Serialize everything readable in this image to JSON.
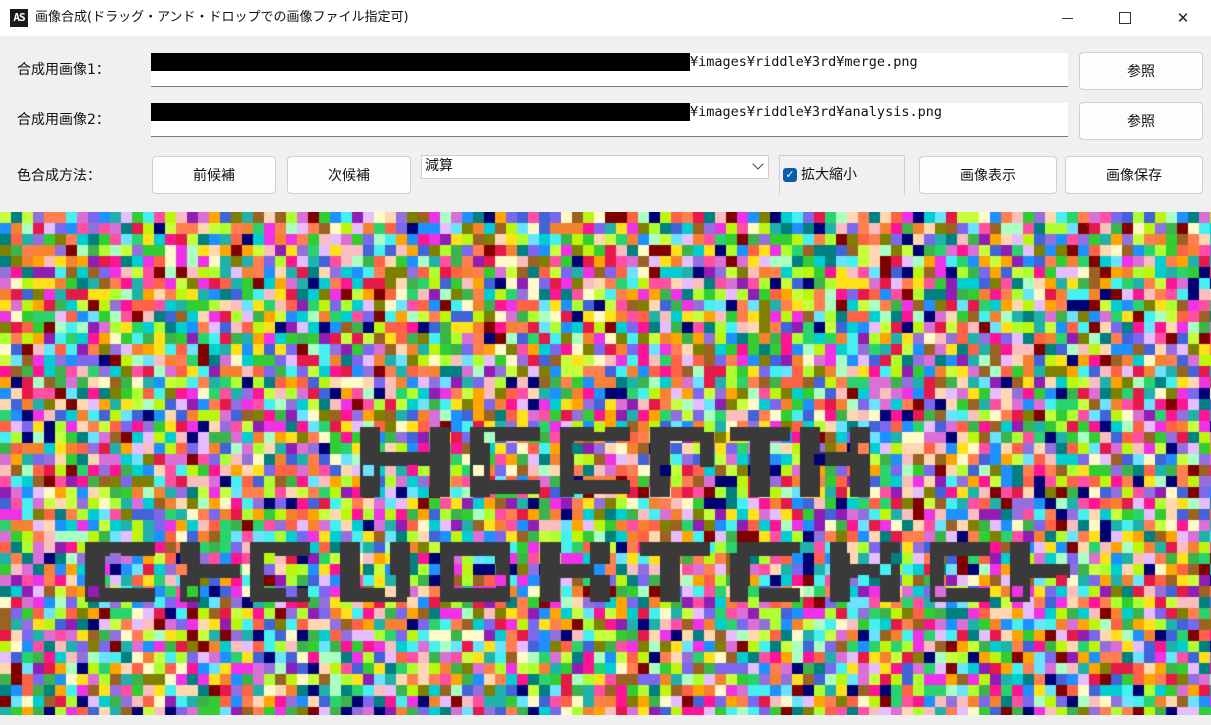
{
  "window": {
    "title": "画像合成(ドラッグ・アンド・ドロップでの画像ファイル指定可)",
    "icon_text": "AS",
    "icon_name": "app-icon",
    "controls": [
      "minimize-icon",
      "maximize-icon",
      "close-icon"
    ],
    "close_glyph": "✕"
  },
  "image1": {
    "label": "合成用画像1：",
    "path_suffix": "¥images¥riddle¥3rd¥merge.png",
    "browse_label": "参照"
  },
  "image2": {
    "label": "合成用画像2：",
    "path_suffix": "¥images¥riddle¥3rd¥analysis.png",
    "browse_label": "参照"
  },
  "method": {
    "label": "色合成方法：",
    "prev_label": "前候補",
    "next_label": "次候補",
    "selected": "減算"
  },
  "scale": {
    "label": "拡大縮小",
    "checked": true,
    "check_glyph": "✓"
  },
  "actions": {
    "show_label": "画像表示",
    "save_label": "画像保存"
  },
  "preview": {
    "description_colors": [
      "#f2f2f2",
      "#3a3a3a"
    ],
    "accent": "#0b5cad"
  }
}
